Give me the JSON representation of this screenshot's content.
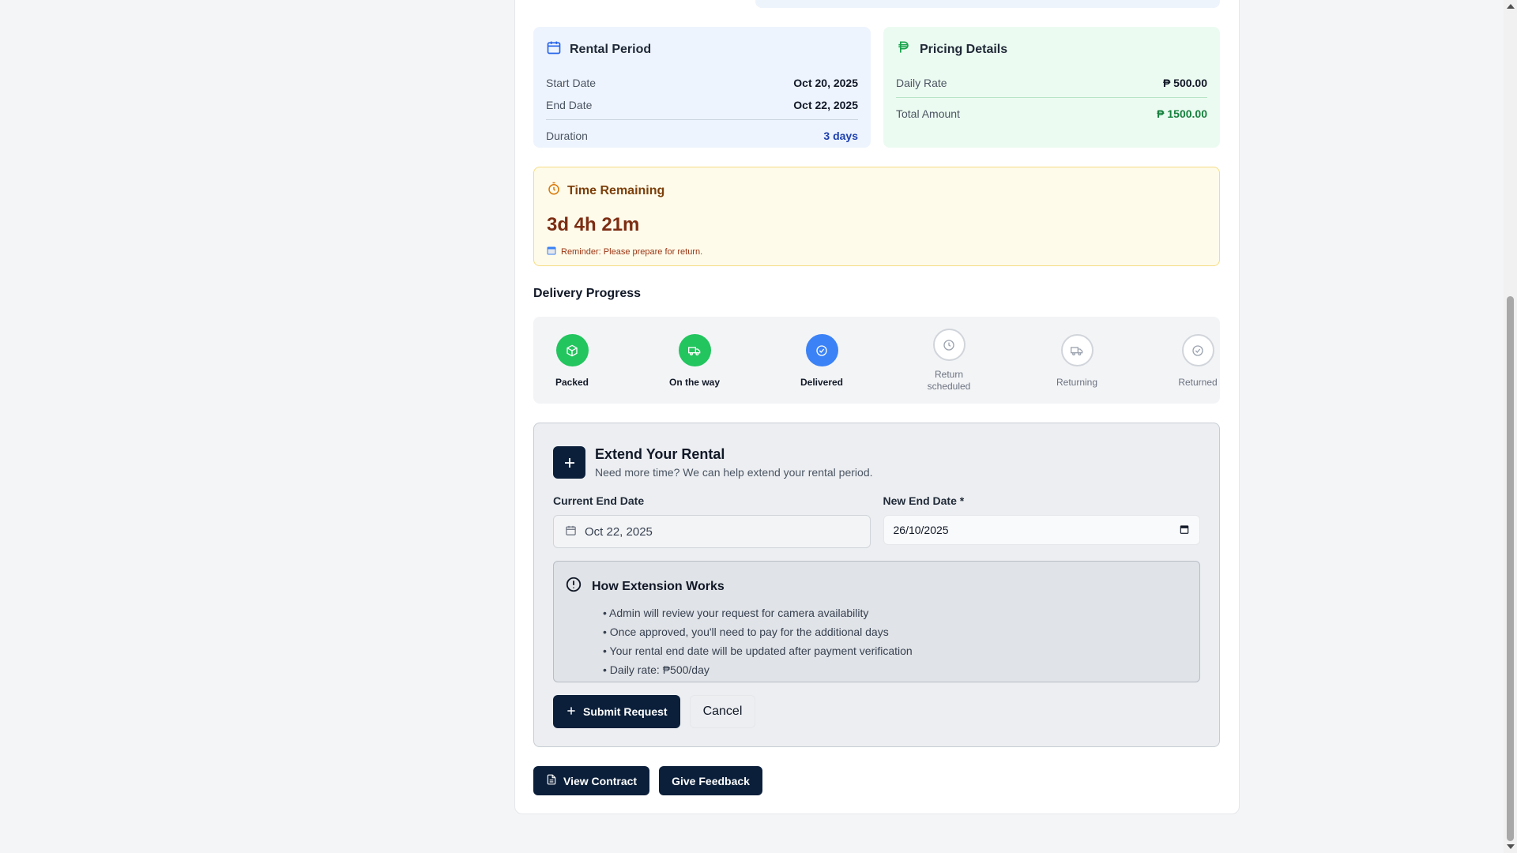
{
  "rental_period": {
    "title": "Rental Period",
    "rows": [
      {
        "label": "Start Date",
        "value": "Oct 20, 2025"
      },
      {
        "label": "End Date",
        "value": "Oct 22, 2025"
      }
    ],
    "duration_label": "Duration",
    "duration_value": "3 days"
  },
  "pricing": {
    "title": "Pricing Details",
    "daily_label": "Daily Rate",
    "daily_value": "₱ 500.00",
    "total_label": "Total Amount",
    "total_value": "₱ 1500.00"
  },
  "time_remaining": {
    "title": "Time Remaining",
    "value": "3d 4h 21m",
    "reminder": "Reminder: Please prepare for return."
  },
  "delivery": {
    "title": "Delivery Progress",
    "steps": [
      {
        "label": "Packed",
        "state": "done",
        "icon": "package-icon"
      },
      {
        "label": "On the way",
        "state": "done",
        "icon": "truck-icon"
      },
      {
        "label": "Delivered",
        "state": "current",
        "icon": "check-circle-icon"
      },
      {
        "label": "Return scheduled",
        "state": "pending",
        "icon": "clock-icon"
      },
      {
        "label": "Returning",
        "state": "pending",
        "icon": "truck-icon"
      },
      {
        "label": "Returned",
        "state": "pending",
        "icon": "check-circle-icon"
      }
    ]
  },
  "extend": {
    "title": "Extend Your Rental",
    "subtitle": "Need more time? We can help extend your rental period.",
    "current_label": "Current End Date",
    "current_value": "Oct 22, 2025",
    "new_label": "New End Date *",
    "new_value": "26/10/2025",
    "how_title": "How Extension Works",
    "how_items": [
      "• Admin will review your request for camera availability",
      "• Once approved, you'll need to pay for the additional days",
      "• Your rental end date will be updated after payment verification",
      "• Daily rate: ₱500/day"
    ],
    "submit_label": "Submit Request",
    "cancel_label": "Cancel"
  },
  "actions": {
    "view_contract": "View Contract",
    "give_feedback": "Give Feedback"
  },
  "colors": {
    "primary": "#0b1f3a",
    "success": "#22c55e",
    "info": "#3b82f6",
    "warning_text": "#7c2d12"
  }
}
